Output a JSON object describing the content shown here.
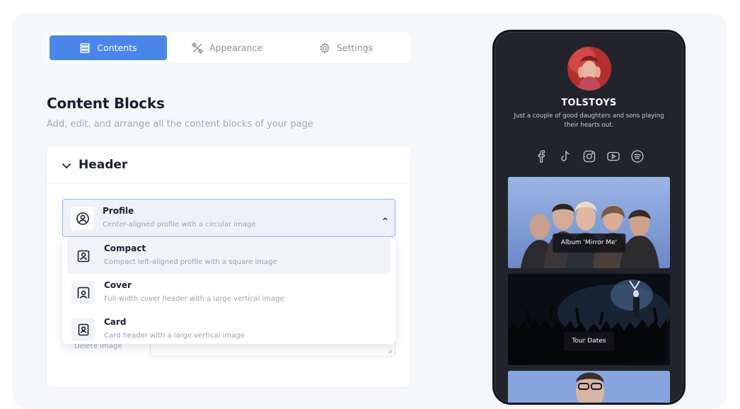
{
  "tabs": [
    {
      "label": "Contents",
      "icon": "stack-icon",
      "active": true
    },
    {
      "label": "Appearance",
      "icon": "brush-ruler-icon",
      "active": false
    },
    {
      "label": "Settings",
      "icon": "gear-icon",
      "active": false
    }
  ],
  "page": {
    "title": "Content Blocks",
    "subtitle": "Add, edit, and arrange all the content blocks of your page"
  },
  "header_section": {
    "label": "Header",
    "selected": {
      "title": "Profile",
      "description": "Center-aligned profile with a circular image",
      "icon": "profile-circle-icon"
    },
    "options": [
      {
        "title": "Compact",
        "description": "Compact left-aligned profile with a square image",
        "icon": "profile-square-icon"
      },
      {
        "title": "Cover",
        "description": "Full-width cover header with a large vertical image",
        "icon": "profile-cover-icon"
      },
      {
        "title": "Card",
        "description": "Card header with a large vertical image",
        "icon": "profile-card-icon"
      }
    ],
    "underlay_label": "Delete Image"
  },
  "preview": {
    "name": "TOLSTOYS",
    "bio": "Just a couple of good daughters and sons playing their hearts out.",
    "socials": [
      "facebook-icon",
      "tiktok-icon",
      "instagram-icon",
      "youtube-icon",
      "spotify-icon"
    ],
    "blocks": [
      {
        "label": "Album 'Mirror Me'"
      },
      {
        "label": "Tour Dates"
      }
    ]
  },
  "colors": {
    "accent": "#4a86e8",
    "panel": "#f5f7fb",
    "phone": "#23242b"
  }
}
